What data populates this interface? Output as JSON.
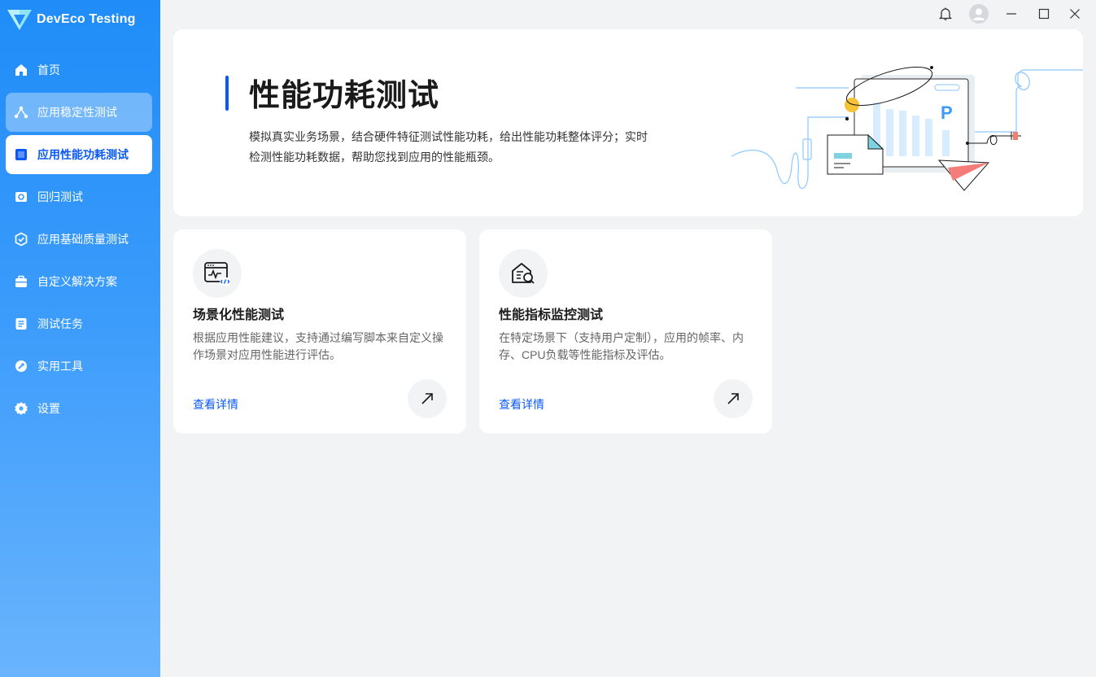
{
  "app": {
    "name": "DevEco Testing"
  },
  "sidebar": {
    "items": [
      {
        "label": "首页",
        "icon": "home-icon"
      },
      {
        "label": "应用稳定性测试",
        "icon": "stability-icon"
      },
      {
        "label": "应用性能功耗测试",
        "icon": "performance-icon"
      },
      {
        "label": "回归测试",
        "icon": "regression-icon"
      },
      {
        "label": "应用基础质量测试",
        "icon": "quality-check-icon"
      },
      {
        "label": "自定义解决方案",
        "icon": "briefcase-icon"
      },
      {
        "label": "测试任务",
        "icon": "task-list-icon"
      },
      {
        "label": "实用工具",
        "icon": "wrench-icon"
      },
      {
        "label": "设置",
        "icon": "gear-icon"
      }
    ],
    "active_index": 2,
    "hover_index": 1
  },
  "banner": {
    "title": "性能功耗测试",
    "desc_line1": "模拟真实业务场景，结合硬件特征测试性能功耗，给出性能功耗整体评分；实时",
    "desc_line2": "检测性能功耗数据，帮助您找到应用的性能瓶颈。",
    "illus_letter": "P"
  },
  "cards": [
    {
      "title": "场景化性能测试",
      "desc": "根据应用性能建议，支持通过编写脚本来自定义操作场景对应用性能进行评估。",
      "link": "查看详情",
      "icon": "code-window-icon"
    },
    {
      "title": "性能指标监控测试",
      "desc": "在特定场景下（支持用户定制），应用的帧率、内存、CPU负载等性能指标及评估。",
      "link": "查看详情",
      "icon": "monitor-search-icon"
    }
  ],
  "colors": {
    "accent": "#0a59f7",
    "sidebar_top": "#1f8cf8",
    "sidebar_bottom": "#6ab4fd",
    "page_bg": "#f1f3f5"
  }
}
